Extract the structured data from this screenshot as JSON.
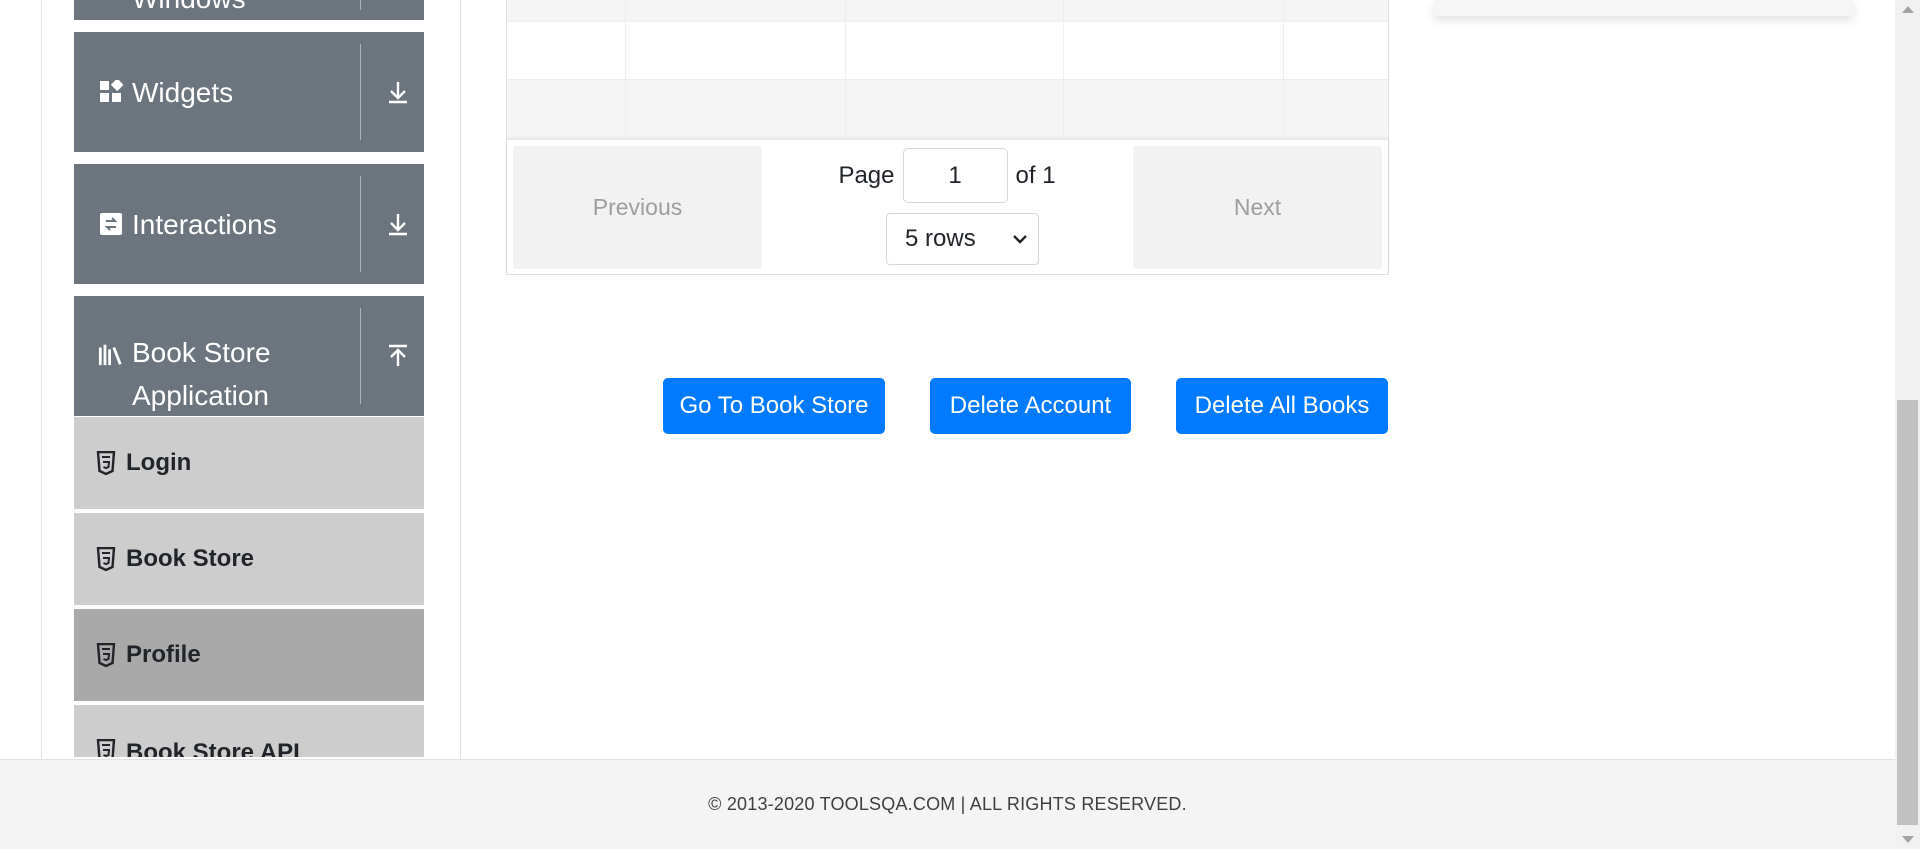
{
  "sidebar": {
    "groups": [
      {
        "label": "Windows",
        "icon": "window-icon",
        "arrow": "download-arrow-icon"
      },
      {
        "label": "Widgets",
        "icon": "widgets-grid-icon",
        "arrow": "download-arrow-icon"
      },
      {
        "label": "Interactions",
        "icon": "interactions-icon",
        "arrow": "download-arrow-icon"
      },
      {
        "label_line1": "Book Store",
        "label_line2": "Application",
        "icon": "books-icon",
        "arrow": "upload-arrow-icon"
      }
    ],
    "book_store_items": [
      {
        "label": "Login",
        "icon": "html5-icon",
        "active": false
      },
      {
        "label": "Book Store",
        "icon": "html5-icon",
        "active": false
      },
      {
        "label": "Profile",
        "icon": "html5-icon",
        "active": true
      },
      {
        "label": "Book Store API",
        "icon": "html5-icon",
        "active": false
      }
    ]
  },
  "pagination": {
    "previous_label": "Previous",
    "next_label": "Next",
    "page_label": "Page",
    "page_value": "1",
    "of_label": "of 1",
    "rows_selected": "5 rows"
  },
  "actions": {
    "go_to_store": "Go To Book Store",
    "delete_account": "Delete Account",
    "delete_all_books": "Delete All Books"
  },
  "footer": {
    "text": "© 2013-2020 TOOLSQA.COM | ALL RIGHTS RESERVED."
  },
  "colors": {
    "sidebar_header": "#6c757d",
    "sub_item": "#cdcdcd",
    "sub_item_active": "#a9a9a9",
    "primary_button": "#007bff"
  }
}
